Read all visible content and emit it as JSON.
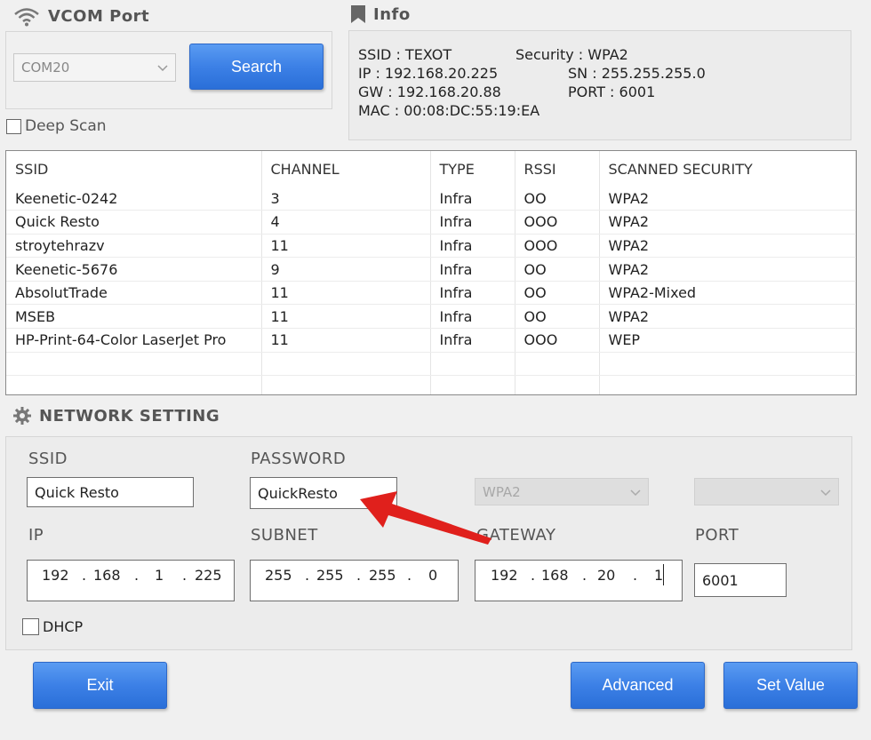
{
  "vcom": {
    "title": "VCOM Port",
    "port_value": "COM20",
    "search_label": "Search",
    "deep_scan_label": "Deep Scan"
  },
  "info": {
    "title": "Info",
    "ssid": "SSID : TEXOT",
    "security": "Security : WPA2",
    "ip": "IP : 192.168.20.225",
    "sn": "SN : 255.255.255.0",
    "gw": "GW : 192.168.20.88",
    "port": "PORT : 6001",
    "mac": "MAC : 00:08:DC:55:19:EA"
  },
  "table": {
    "headers": [
      "SSID",
      "CHANNEL",
      "TYPE",
      "RSSI",
      "SCANNED SECURITY"
    ],
    "rows": [
      [
        "Keenetic-0242",
        "3",
        "Infra",
        "OO",
        "WPA2"
      ],
      [
        "Quick Resto",
        "4",
        "Infra",
        "OOO",
        "WPA2"
      ],
      [
        "stroytehrazv",
        "11",
        "Infra",
        "OOO",
        "WPA2"
      ],
      [
        "Keenetic-5676",
        "9",
        "Infra",
        "OO",
        "WPA2"
      ],
      [
        "AbsolutTrade",
        "11",
        "Infra",
        "OO",
        "WPA2-Mixed"
      ],
      [
        "MSEB",
        "11",
        "Infra",
        "OO",
        "WPA2"
      ],
      [
        "HP-Print-64-Color LaserJet Pro",
        "11",
        "Infra",
        "OOO",
        "WEP"
      ]
    ]
  },
  "network": {
    "title": "NETWORK SETTING",
    "ssid_label": "SSID",
    "ssid_value": "Quick Resto",
    "password_label": "PASSWORD",
    "password_value": "QuickResto",
    "security_value": "WPA2",
    "ip_label": "IP",
    "ip_octets": [
      "192",
      "168",
      "1",
      "225"
    ],
    "subnet_label": "SUBNET",
    "subnet_octets": [
      "255",
      "255",
      "255",
      "0"
    ],
    "gateway_label": "GATEWAY",
    "gateway_octets": [
      "192",
      "168",
      "20",
      "1"
    ],
    "port_label": "PORT",
    "port_value": "6001",
    "dhcp_label": "DHCP"
  },
  "buttons": {
    "exit": "Exit",
    "advanced": "Advanced",
    "set_value": "Set Value"
  },
  "colors": {
    "button_blue": "#3c80e6",
    "arrow_red": "#e0201c"
  }
}
